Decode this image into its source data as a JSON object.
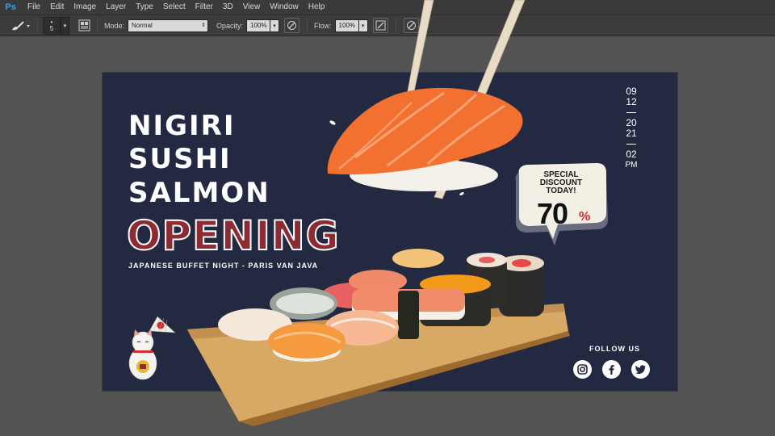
{
  "app": {
    "logo": "Ps"
  },
  "menu": [
    "File",
    "Edit",
    "Image",
    "Layer",
    "Type",
    "Select",
    "Filter",
    "3D",
    "View",
    "Window",
    "Help"
  ],
  "options": {
    "brush_size": "5",
    "brush_size_top": "•",
    "mode_label": "Mode:",
    "mode_value": "Normal",
    "opacity_label": "Opacity:",
    "opacity_value": "100%",
    "flow_label": "Flow:",
    "flow_value": "100%"
  },
  "poster": {
    "headline": [
      "NIGIRI",
      "SUSHI",
      "SALMON"
    ],
    "opening": "OPENING",
    "subtitle": "JAPANESE BUFFET NIGHT - PARIS VAN JAVA",
    "date": {
      "month": "09",
      "day": "12",
      "year_a": "20",
      "year_b": "21",
      "hour": "02",
      "ampm": "PM"
    },
    "bubble": {
      "line1": "SPECIAL",
      "line2": "DISCOUNT",
      "line3": "TODAY!",
      "percent": "70",
      "percent_sign": "%"
    },
    "follow": "FOLLOW US",
    "social": [
      "instagram-icon",
      "facebook-icon",
      "twitter-icon"
    ]
  },
  "colors": {
    "canvas_bg": "#222940",
    "opening_red": "#8d2a32",
    "discount_red": "#d42b2b",
    "workspace": "#535353"
  }
}
